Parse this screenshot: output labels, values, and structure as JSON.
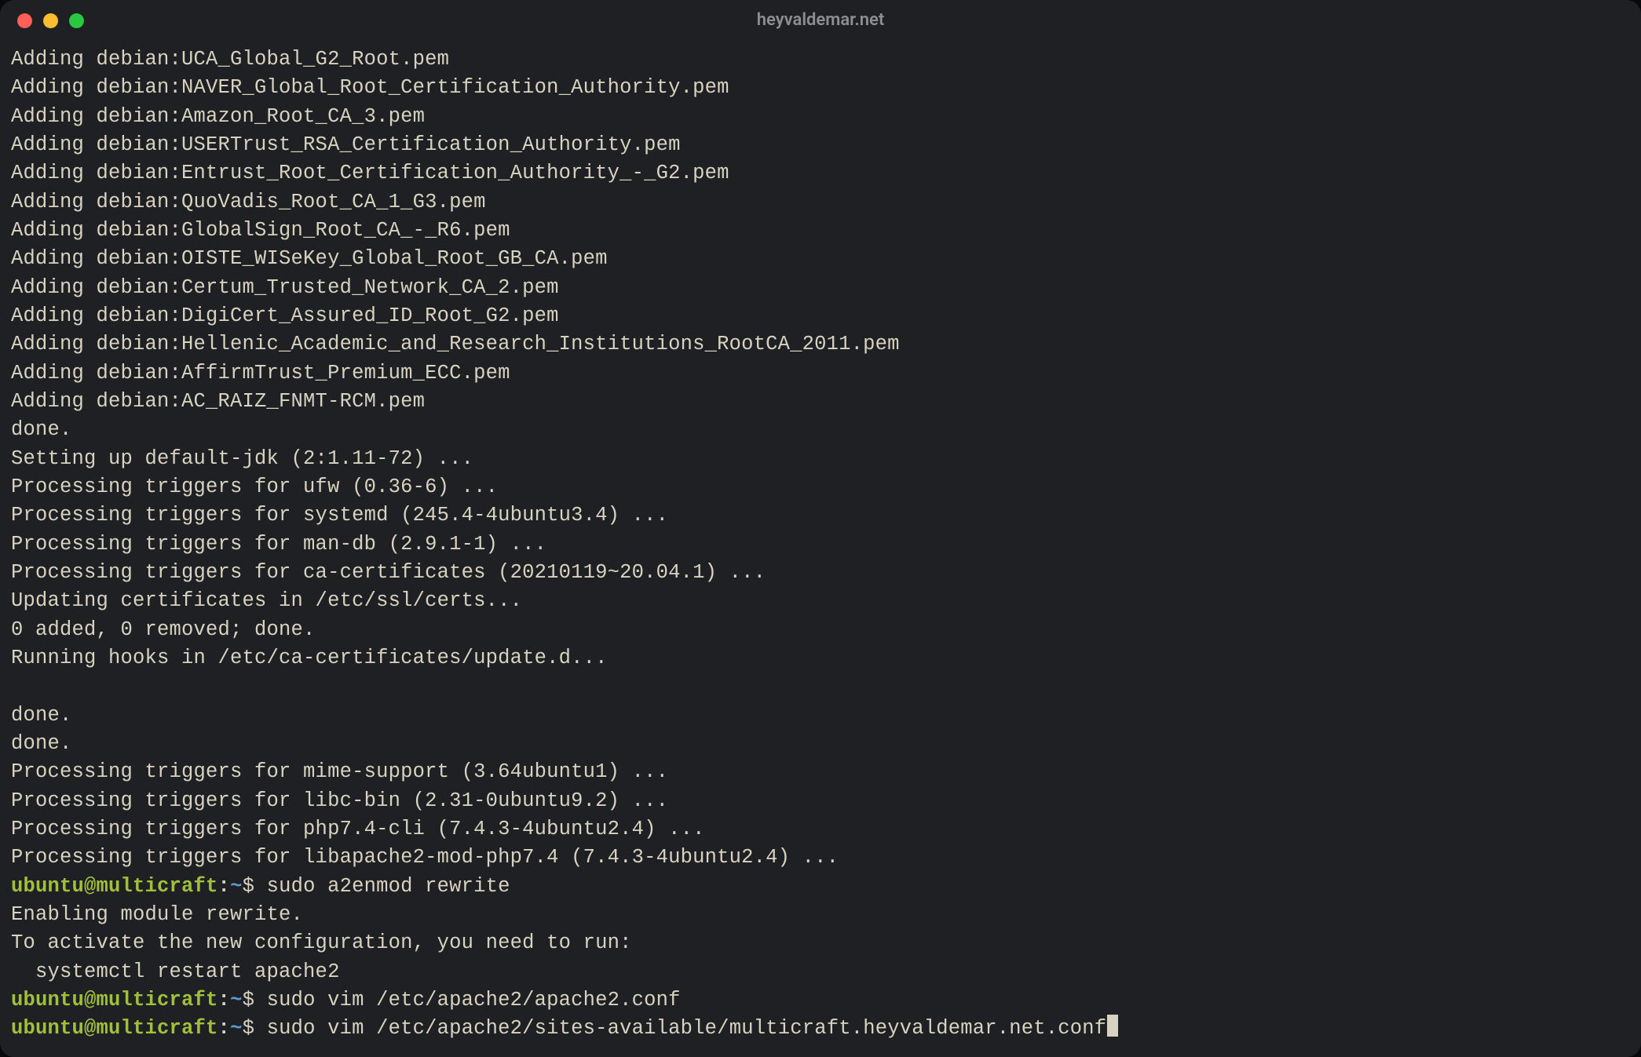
{
  "window": {
    "title": "heyvaldemar.net"
  },
  "prompt": {
    "user": "ubuntu",
    "host": "multicraft",
    "path": "~",
    "symbol": "$"
  },
  "output_lines": [
    "Adding debian:UCA_Global_G2_Root.pem",
    "Adding debian:NAVER_Global_Root_Certification_Authority.pem",
    "Adding debian:Amazon_Root_CA_3.pem",
    "Adding debian:USERTrust_RSA_Certification_Authority.pem",
    "Adding debian:Entrust_Root_Certification_Authority_-_G2.pem",
    "Adding debian:QuoVadis_Root_CA_1_G3.pem",
    "Adding debian:GlobalSign_Root_CA_-_R6.pem",
    "Adding debian:OISTE_WISeKey_Global_Root_GB_CA.pem",
    "Adding debian:Certum_Trusted_Network_CA_2.pem",
    "Adding debian:DigiCert_Assured_ID_Root_G2.pem",
    "Adding debian:Hellenic_Academic_and_Research_Institutions_RootCA_2011.pem",
    "Adding debian:AffirmTrust_Premium_ECC.pem",
    "Adding debian:AC_RAIZ_FNMT-RCM.pem",
    "done.",
    "Setting up default-jdk (2:1.11-72) ...",
    "Processing triggers for ufw (0.36-6) ...",
    "Processing triggers for systemd (245.4-4ubuntu3.4) ...",
    "Processing triggers for man-db (2.9.1-1) ...",
    "Processing triggers for ca-certificates (20210119~20.04.1) ...",
    "Updating certificates in /etc/ssl/certs...",
    "0 added, 0 removed; done.",
    "Running hooks in /etc/ca-certificates/update.d...",
    "",
    "done.",
    "done.",
    "Processing triggers for mime-support (3.64ubuntu1) ...",
    "Processing triggers for libc-bin (2.31-0ubuntu9.2) ...",
    "Processing triggers for php7.4-cli (7.4.3-4ubuntu2.4) ...",
    "Processing triggers for libapache2-mod-php7.4 (7.4.3-4ubuntu2.4) ..."
  ],
  "history": [
    {
      "command": "sudo a2enmod rewrite",
      "output": [
        "Enabling module rewrite.",
        "To activate the new configuration, you need to run:",
        "  systemctl restart apache2"
      ]
    },
    {
      "command": "sudo vim /etc/apache2/apache2.conf",
      "output": []
    }
  ],
  "current_command": "sudo vim /etc/apache2/sites-available/multicraft.heyvaldemar.net.conf"
}
